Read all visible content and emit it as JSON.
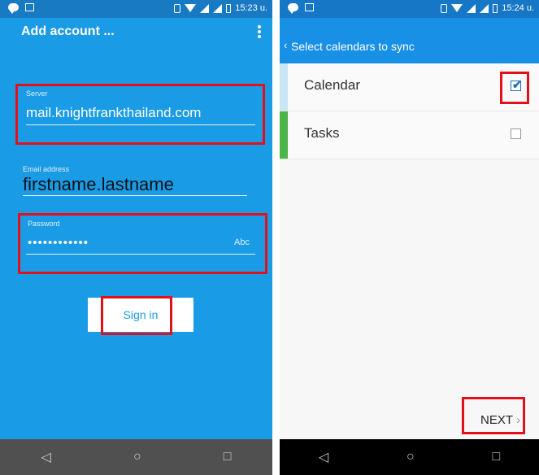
{
  "left": {
    "status": {
      "time": "15:23 u."
    },
    "title": "Add account ...",
    "server": {
      "label": "Server",
      "value": "mail.knightfrankthailand.com"
    },
    "email": {
      "label": "Email address",
      "value": "firstname.lastname"
    },
    "password": {
      "label": "Password",
      "value": "••••••••••••",
      "toggle": "Abc"
    },
    "sign_in": "Sign in"
  },
  "right": {
    "status": {
      "time": "15:24 u."
    },
    "title": "Select calendars to sync",
    "calendars": [
      {
        "label": "Calendar",
        "checked": true,
        "color": "#c9e6f5"
      },
      {
        "label": "Tasks",
        "checked": false,
        "color": "#4cb548"
      }
    ],
    "next": "NEXT"
  },
  "nav": {
    "back": "◁",
    "home": "○",
    "recents": "□"
  },
  "colors": {
    "accent": "#1a9be6",
    "highlight": "#e3101a"
  }
}
